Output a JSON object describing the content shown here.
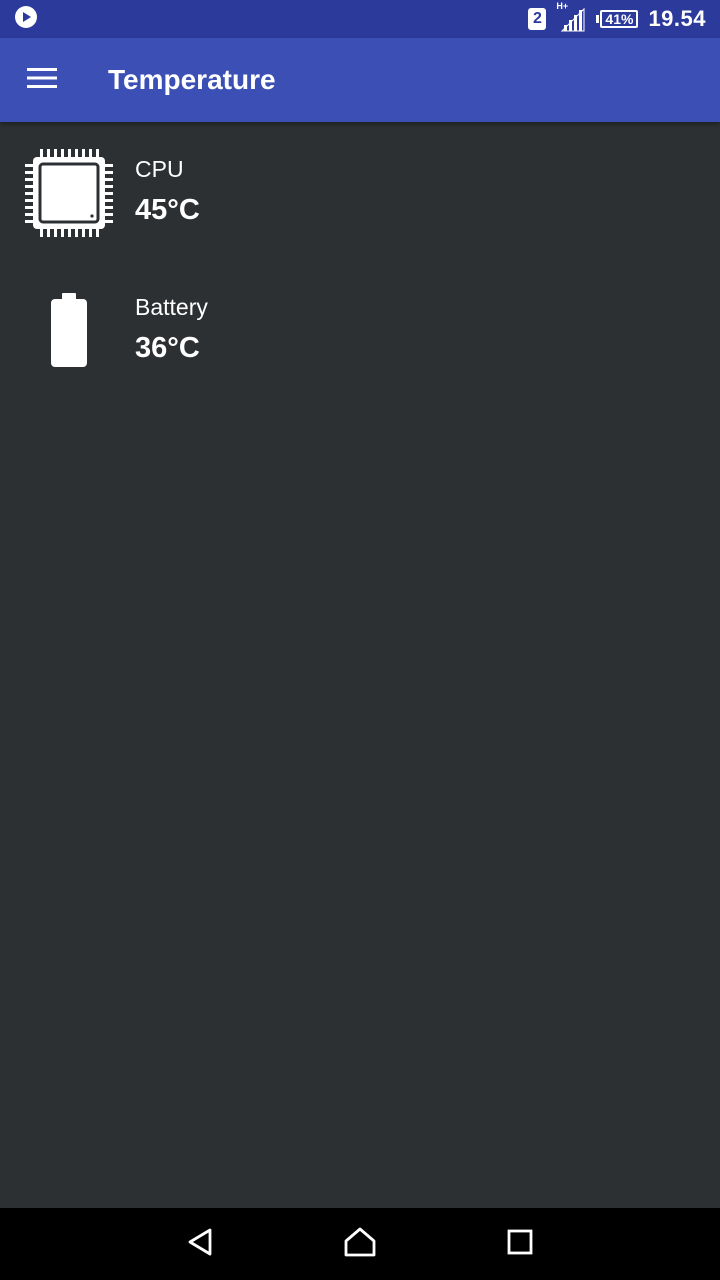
{
  "status_bar": {
    "left_icon": "play-notification-icon",
    "sim_slot": "2",
    "network_type": "H+",
    "signal_icon": "signal-icon",
    "battery_percent": "41%",
    "time": "19.54"
  },
  "app_bar": {
    "menu_icon": "hamburger-menu-icon",
    "title": "Temperature",
    "color": "#3c4fb5"
  },
  "sensors": [
    {
      "icon": "cpu-chip-icon",
      "label": "CPU",
      "value": "45°C"
    },
    {
      "icon": "battery-icon",
      "label": "Battery",
      "value": "36°C"
    }
  ],
  "nav_bar": {
    "back_icon": "back-triangle-icon",
    "home_icon": "home-icon",
    "recents_icon": "recents-square-icon"
  },
  "colors": {
    "background": "#2d3033",
    "status_bar": "#2c3a9c",
    "nav_bar": "#000000"
  }
}
